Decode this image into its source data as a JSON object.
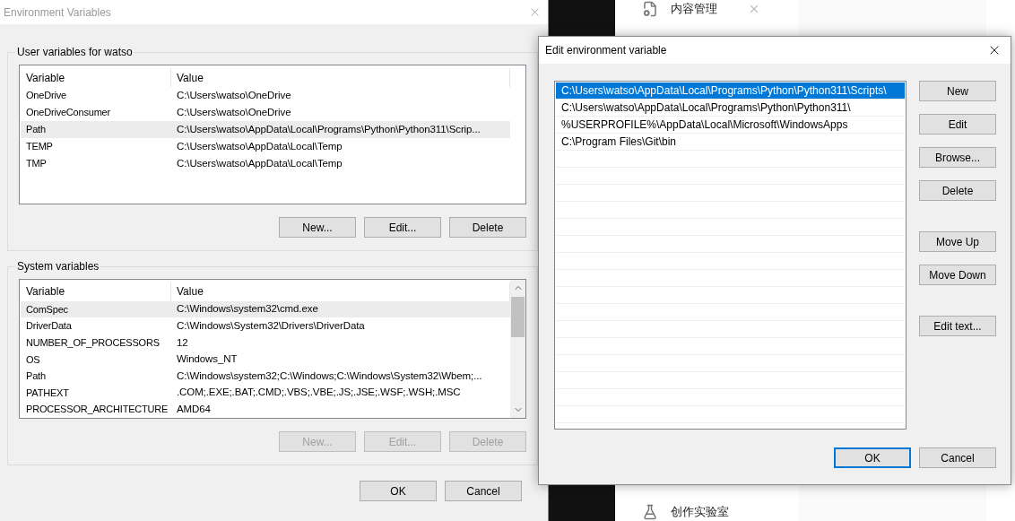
{
  "background_app": {
    "items": [
      {
        "label": "内容管理",
        "kind": "content"
      },
      {
        "label": "创作实验室",
        "kind": "lab"
      }
    ]
  },
  "environment_window": {
    "title": "Environment Variables",
    "groups": [
      {
        "label": "User variables for watso",
        "scrollbar": false,
        "columns": [
          "Variable",
          "Value"
        ],
        "rows": [
          {
            "variable": "OneDrive",
            "value": "C:\\Users\\watso\\OneDrive",
            "selected": false
          },
          {
            "variable": "OneDriveConsumer",
            "value": "C:\\Users\\watso\\OneDrive",
            "selected": false
          },
          {
            "variable": "Path",
            "value": "C:\\Users\\watso\\AppData\\Local\\Programs\\Python\\Python311\\Scrip...",
            "selected": true
          },
          {
            "variable": "TEMP",
            "value": "C:\\Users\\watso\\AppData\\Local\\Temp",
            "selected": false
          },
          {
            "variable": "TMP",
            "value": "C:\\Users\\watso\\AppData\\Local\\Temp",
            "selected": false
          }
        ],
        "buttons": [
          {
            "label": "New...",
            "disabled": false
          },
          {
            "label": "Edit...",
            "disabled": false
          },
          {
            "label": "Delete",
            "disabled": false
          }
        ]
      },
      {
        "label": "System variables",
        "scrollbar": true,
        "columns": [
          "Variable",
          "Value"
        ],
        "rows": [
          {
            "variable": "ComSpec",
            "value": "C:\\Windows\\system32\\cmd.exe",
            "selected": true
          },
          {
            "variable": "DriverData",
            "value": "C:\\Windows\\System32\\Drivers\\DriverData",
            "selected": false
          },
          {
            "variable": "NUMBER_OF_PROCESSORS",
            "value": "12",
            "selected": false
          },
          {
            "variable": "OS",
            "value": "Windows_NT",
            "selected": false
          },
          {
            "variable": "Path",
            "value": "C:\\Windows\\system32;C:\\Windows;C:\\Windows\\System32\\Wbem;...",
            "selected": false
          },
          {
            "variable": "PATHEXT",
            "value": ".COM;.EXE;.BAT;.CMD;.VBS;.VBE;.JS;.JSE;.WSF;.WSH;.MSC",
            "selected": false
          },
          {
            "variable": "PROCESSOR_ARCHITECTURE",
            "value": "AMD64",
            "selected": false
          }
        ],
        "buttons": [
          {
            "label": "New...",
            "disabled": true
          },
          {
            "label": "Edit...",
            "disabled": true
          },
          {
            "label": "Delete",
            "disabled": true
          }
        ]
      }
    ],
    "buttons": [
      {
        "label": "OK",
        "default": false
      },
      {
        "label": "Cancel",
        "default": false
      }
    ]
  },
  "edit_dialog": {
    "title": "Edit environment variable",
    "entries": [
      {
        "text": "C:\\Users\\watso\\AppData\\Local\\Programs\\Python\\Python311\\Scripts\\",
        "selected": true
      },
      {
        "text": "C:\\Users\\watso\\AppData\\Local\\Programs\\Python\\Python311\\",
        "selected": false
      },
      {
        "text": "%USERPROFILE%\\AppData\\Local\\Microsoft\\WindowsApps",
        "selected": false
      },
      {
        "text": "C:\\Program Files\\Git\\bin",
        "selected": false
      }
    ],
    "side_button_groups": [
      [
        {
          "label": "New",
          "disabled": false
        },
        {
          "label": "Edit",
          "disabled": false
        },
        {
          "label": "Browse...",
          "disabled": false
        },
        {
          "label": "Delete",
          "disabled": false
        }
      ],
      [
        {
          "label": "Move Up",
          "disabled": false
        },
        {
          "label": "Move Down",
          "disabled": false
        }
      ],
      [
        {
          "label": "Edit text...",
          "disabled": false
        }
      ]
    ],
    "buttons": [
      {
        "label": "OK",
        "default": true
      },
      {
        "label": "Cancel",
        "default": false
      }
    ]
  }
}
